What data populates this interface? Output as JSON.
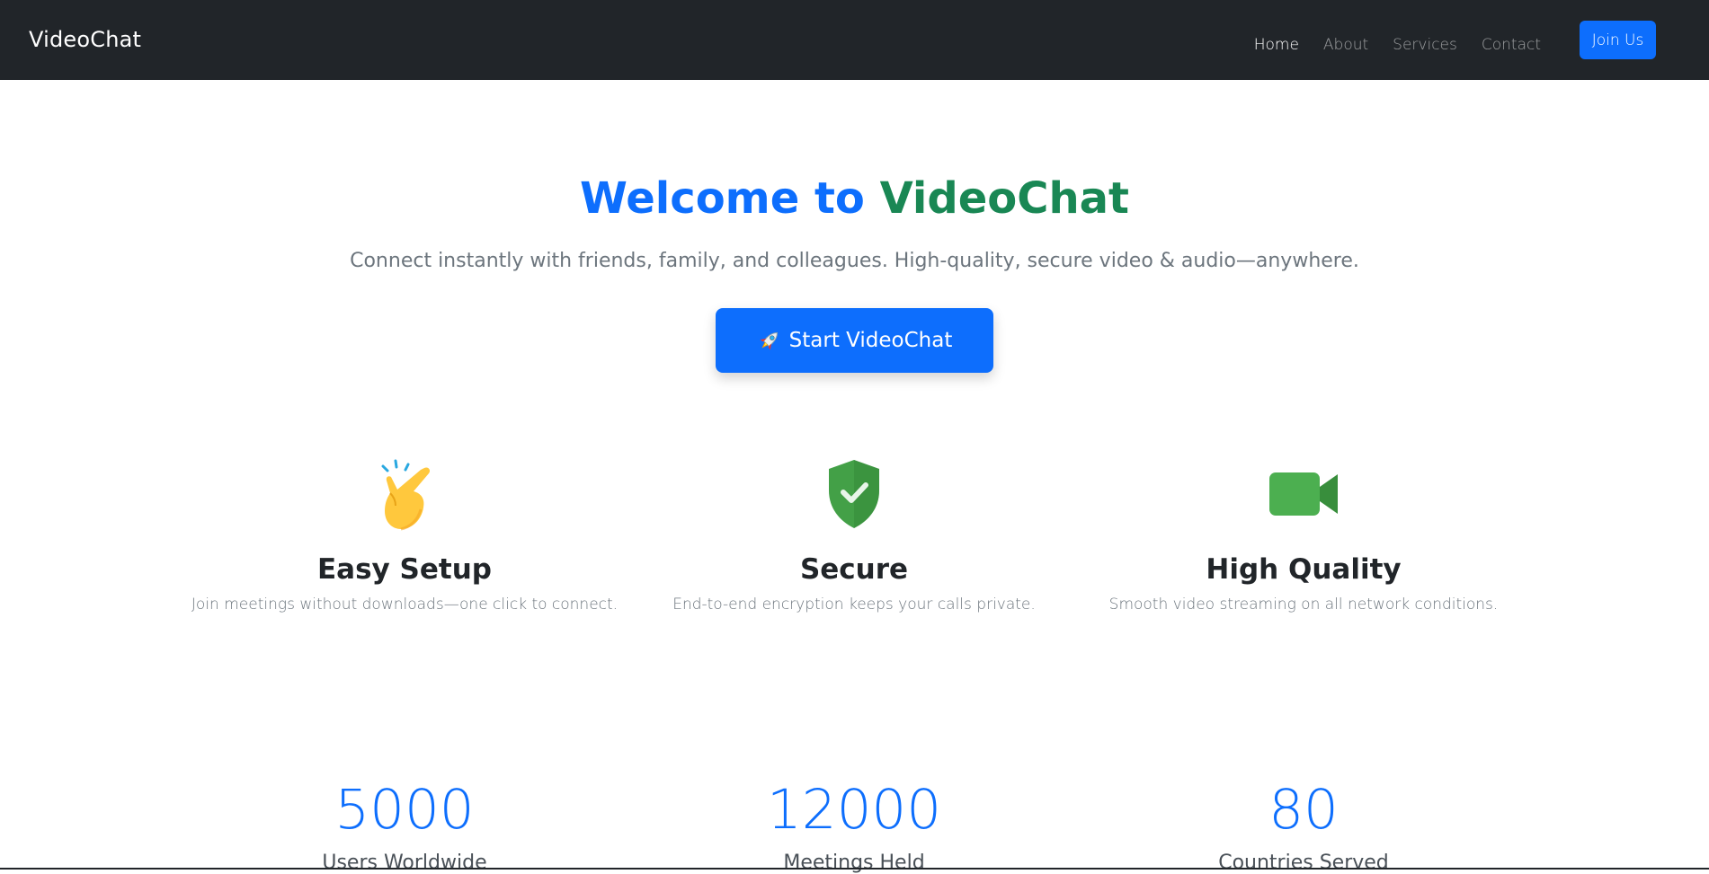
{
  "nav": {
    "brand": "VideoChat",
    "links": [
      "Home",
      "About",
      "Services",
      "Contact"
    ],
    "active": "Home",
    "join_label": "Join Us"
  },
  "hero": {
    "title_part1": "Welcome to ",
    "title_part2": "VideoChat",
    "subtitle": "Connect instantly with friends, family, and colleagues. High-quality, secure video & audio—anywhere.",
    "cta_label": "Start VideoChat",
    "cta_icon": "rocket-icon"
  },
  "features": [
    {
      "icon": "pointing-hand-icon",
      "title": "Easy Setup",
      "desc": "Join meetings without downloads—one click to connect."
    },
    {
      "icon": "shield-check-icon",
      "title": "Secure",
      "desc": "End-to-end encryption keeps your calls private."
    },
    {
      "icon": "video-camera-icon",
      "title": "High Quality",
      "desc": "Smooth video streaming on all network conditions."
    }
  ],
  "stats": [
    {
      "number": "5000",
      "label": "Users Worldwide"
    },
    {
      "number": "12000",
      "label": "Meetings Held"
    },
    {
      "number": "80",
      "label": "Countries Served"
    }
  ],
  "colors": {
    "navbar_bg": "#212529",
    "primary": "#0d6efd",
    "success": "#198754",
    "shield_green": "#43a047",
    "camera_green": "#4caf50"
  }
}
